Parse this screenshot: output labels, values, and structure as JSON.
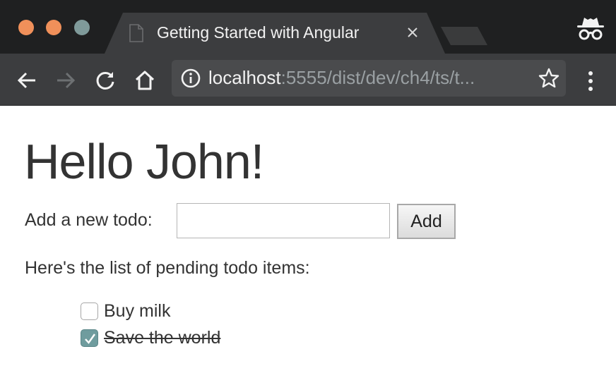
{
  "browser": {
    "tab_title": "Getting Started with Angular",
    "url_host": "localhost",
    "url_rest": ":5555/dist/dev/ch4/ts/t..."
  },
  "page": {
    "heading": "Hello John!",
    "add_label": "Add a new todo:",
    "input_value": "",
    "add_button_label": "Add",
    "list_heading": "Here's the list of pending todo items:",
    "todos": [
      {
        "label": "Buy milk",
        "completed": false
      },
      {
        "label": "Save the world",
        "completed": true
      }
    ]
  },
  "colors": {
    "titlebar": "#1f2021",
    "toolbar": "#3c3d3f",
    "close_button": "#f0905a",
    "minimize_button": "#f0905a",
    "maximize_button": "#7f9a9a",
    "checkbox_checked": "#6f9c9e"
  },
  "icons": [
    "back-arrow-icon",
    "forward-arrow-icon",
    "reload-icon",
    "home-icon",
    "info-icon",
    "star-icon",
    "menu-icon",
    "incognito-icon",
    "page-icon",
    "close-icon",
    "checkmark-icon"
  ]
}
